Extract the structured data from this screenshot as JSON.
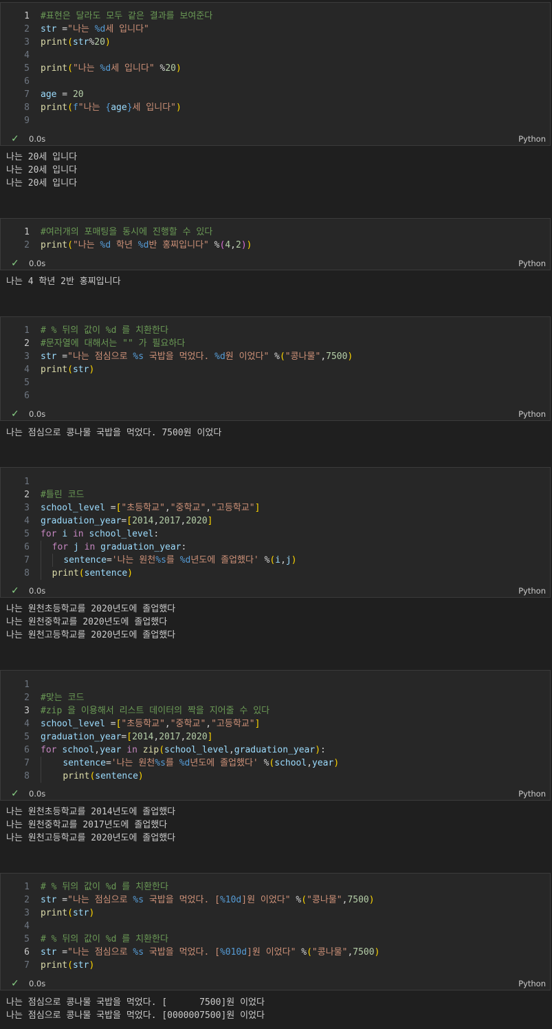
{
  "cells": [
    {
      "lines": [
        {
          "no": "1",
          "text": "#표현은 달라도 모두 같은 결과를 보여준다"
        },
        {
          "no": "2",
          "text": "str =\"나는 %d세 입니다\""
        },
        {
          "no": "3",
          "text": "print(str%20)"
        },
        {
          "no": "4",
          "text": ""
        },
        {
          "no": "5",
          "text": "print(\"나는 %d세 입니다\" %20)"
        },
        {
          "no": "6",
          "text": ""
        },
        {
          "no": "7",
          "text": "age = 20"
        },
        {
          "no": "8",
          "text": "print(f\"나는 {age}세 입니다\")"
        },
        {
          "no": "9",
          "text": ""
        }
      ],
      "time": "0.0s",
      "lang": "Python",
      "output": [
        "나는 20세 입니다",
        "나는 20세 입니다",
        "나는 20세 입니다"
      ]
    },
    {
      "lines": [
        {
          "no": "1",
          "text": "#여러개의 포매팅을 동시에 진행할 수 있다"
        },
        {
          "no": "2",
          "text": "print(\"나는 %d 학년 %d반 홍찌입니다\" %(4,2))"
        }
      ],
      "time": "0.0s",
      "lang": "Python",
      "output": [
        "나는 4 학년 2반 홍찌입니다"
      ]
    },
    {
      "lines": [
        {
          "no": "1",
          "text": "# % 뒤의 값이 %d 를 치환한다"
        },
        {
          "no": "2",
          "text": "#문자열에 대해서는 \"\" 가 필요하다"
        },
        {
          "no": "3",
          "text": "str =\"나는 점심으로 %s 국밥을 먹었다. %d원 이었다\" %(\"콩나물\",7500)"
        },
        {
          "no": "4",
          "text": "print(str)"
        },
        {
          "no": "5",
          "text": ""
        },
        {
          "no": "6",
          "text": ""
        }
      ],
      "time": "0.0s",
      "lang": "Python",
      "output": [
        "나는 점심으로 콩나물 국밥을 먹었다. 7500원 이었다"
      ]
    },
    {
      "lines": [
        {
          "no": "1",
          "text": ""
        },
        {
          "no": "2",
          "text": "#틀린 코드"
        },
        {
          "no": "3",
          "text": "school_level =[\"초등학교\",\"중학교\",\"고등학교\"]"
        },
        {
          "no": "4",
          "text": "graduation_year=[2014,2017,2020]"
        },
        {
          "no": "5",
          "text": "for i in school_level:"
        },
        {
          "no": "6",
          "text": "  for j in graduation_year:"
        },
        {
          "no": "7",
          "text": "    sentence='나는 원천%s를 %d년도에 졸업했다' %(i,j)"
        },
        {
          "no": "8",
          "text": "  print(sentence)"
        }
      ],
      "time": "0.0s",
      "lang": "Python",
      "output": [
        "나는 원천초등학교를 2020년도에 졸업했다",
        "나는 원천중학교를 2020년도에 졸업했다",
        "나는 원천고등학교를 2020년도에 졸업했다"
      ]
    },
    {
      "lines": [
        {
          "no": "1",
          "text": ""
        },
        {
          "no": "2",
          "text": "#맞는 코드"
        },
        {
          "no": "3",
          "text": "#zip 을 이용해서 리스트 데이터의 짝을 지어줄 수 있다"
        },
        {
          "no": "4",
          "text": "school_level =[\"초등학교\",\"중학교\",\"고등학교\"]"
        },
        {
          "no": "5",
          "text": "graduation_year=[2014,2017,2020]"
        },
        {
          "no": "6",
          "text": "for school,year in zip(school_level,graduation_year):"
        },
        {
          "no": "7",
          "text": "    sentence='나는 원천%s를 %d년도에 졸업했다' %(school,year)"
        },
        {
          "no": "8",
          "text": "    print(sentence)"
        }
      ],
      "time": "0.0s",
      "lang": "Python",
      "output": [
        "나는 원천초등학교를 2014년도에 졸업했다",
        "나는 원천중학교를 2017년도에 졸업했다",
        "나는 원천고등학교를 2020년도에 졸업했다"
      ]
    },
    {
      "lines": [
        {
          "no": "1",
          "text": "# % 뒤의 값이 %d 를 치환한다"
        },
        {
          "no": "2",
          "text": "str =\"나는 점심으로 %s 국밥을 먹었다. [%10d]원 이었다\" %(\"콩나물\",7500)"
        },
        {
          "no": "3",
          "text": "print(str)"
        },
        {
          "no": "4",
          "text": ""
        },
        {
          "no": "5",
          "text": "# % 뒤의 값이 %d 를 치환한다"
        },
        {
          "no": "6",
          "text": "str =\"나는 점심으로 %s 국밥을 먹었다. [%010d]원 이었다\" %(\"콩나물\",7500)"
        },
        {
          "no": "7",
          "text": "print(str)"
        }
      ],
      "time": "0.0s",
      "lang": "Python",
      "output": [
        "나는 점심으로 콩나물 국밥을 먹었다. [      7500]원 이었다",
        "나는 점심으로 콩나물 국밥을 먹었다. [0000007500]원 이었다"
      ]
    }
  ]
}
